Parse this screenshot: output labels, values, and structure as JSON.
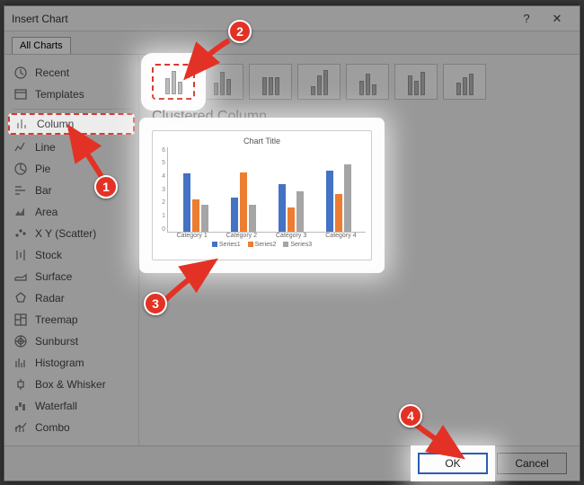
{
  "dialog": {
    "title": "Insert Chart",
    "help_icon": "?",
    "close_icon": "✕"
  },
  "tabs": {
    "all_charts": "All Charts"
  },
  "sidebar": {
    "items": [
      {
        "label": "Recent",
        "icon": "recent"
      },
      {
        "label": "Templates",
        "icon": "templates"
      },
      {
        "label": "Column",
        "icon": "column",
        "selected": true
      },
      {
        "label": "Line",
        "icon": "line"
      },
      {
        "label": "Pie",
        "icon": "pie"
      },
      {
        "label": "Bar",
        "icon": "bar"
      },
      {
        "label": "Area",
        "icon": "area"
      },
      {
        "label": "X Y (Scatter)",
        "icon": "scatter"
      },
      {
        "label": "Stock",
        "icon": "stock"
      },
      {
        "label": "Surface",
        "icon": "surface"
      },
      {
        "label": "Radar",
        "icon": "radar"
      },
      {
        "label": "Treemap",
        "icon": "treemap"
      },
      {
        "label": "Sunburst",
        "icon": "sunburst"
      },
      {
        "label": "Histogram",
        "icon": "histogram"
      },
      {
        "label": "Box & Whisker",
        "icon": "box"
      },
      {
        "label": "Waterfall",
        "icon": "waterfall"
      },
      {
        "label": "Combo",
        "icon": "combo"
      }
    ]
  },
  "content": {
    "subtype_count": 7,
    "preview_title": "Clustered Column"
  },
  "chart_data": {
    "type": "bar",
    "title": "Chart Title",
    "categories": [
      "Category 1",
      "Category 2",
      "Category 3",
      "Category 4"
    ],
    "series": [
      {
        "name": "Series1",
        "values": [
          4.3,
          2.5,
          3.5,
          4.5
        ],
        "color": "#4472c4"
      },
      {
        "name": "Series2",
        "values": [
          2.4,
          4.4,
          1.8,
          2.8
        ],
        "color": "#ed7d31"
      },
      {
        "name": "Series3",
        "values": [
          2.0,
          2.0,
          3.0,
          5.0
        ],
        "color": "#a5a5a5"
      }
    ],
    "ylim": [
      0,
      6
    ],
    "yticks": [
      0,
      1,
      2,
      3,
      4,
      5,
      6
    ],
    "xlabel": "",
    "ylabel": ""
  },
  "footer": {
    "ok": "OK",
    "cancel": "Cancel"
  },
  "annotations": {
    "step1": "1",
    "step2": "2",
    "step3": "3",
    "step4": "4"
  }
}
